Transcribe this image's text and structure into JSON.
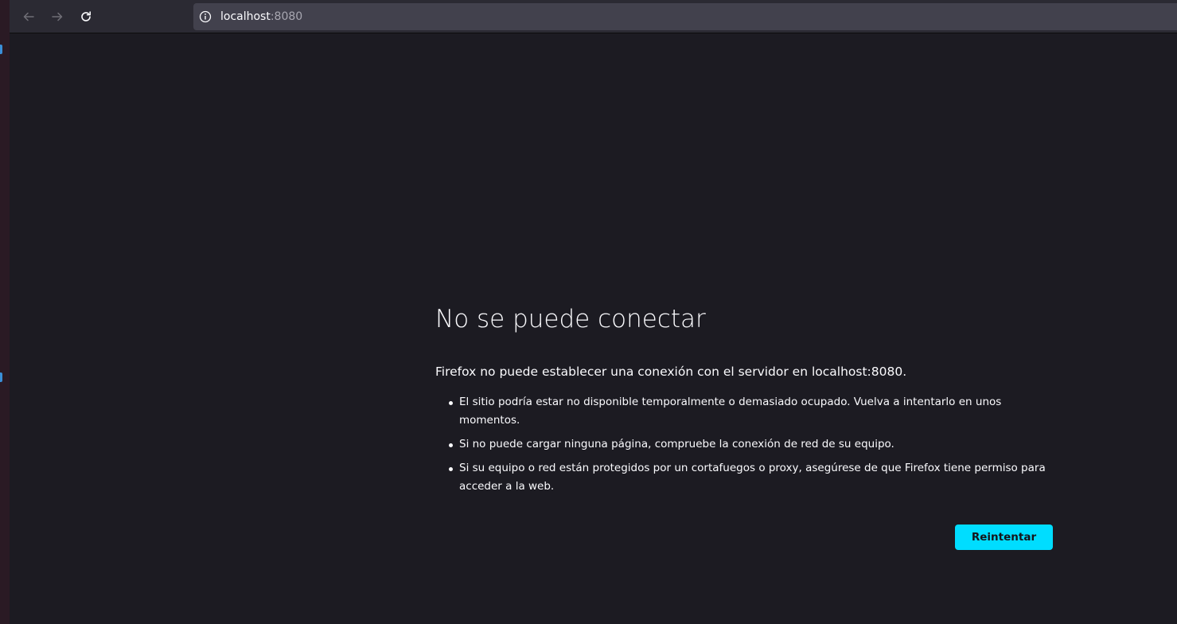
{
  "browser": {
    "url_host": "localhost",
    "url_port": ":8080",
    "icons": {
      "back": "arrow-left-icon",
      "forward": "arrow-right-icon",
      "reload": "reload-icon",
      "site_info": "info-icon"
    }
  },
  "error": {
    "title": "No se puede conectar",
    "intro": "Firefox no puede establecer una conexión con el servidor en localhost:8080.",
    "items": [
      "El sitio podría estar no disponible temporalmente o demasiado ocupado. Vuelva a intentarlo en unos momentos.",
      "Si no puede cargar ninguna página, compruebe la conexión de red de su equipo.",
      "Si su equipo o red están protegidos por un cortafuegos o proxy, asegúrese de que Firefox tiene permiso para acceder a la web."
    ],
    "retry_label": "Reintentar"
  },
  "colors": {
    "page_background": "#1c1b22",
    "toolbar_background": "#2b2a33",
    "urlbar_background": "#42414d",
    "button_accent": "#00ddff",
    "text": "#fbfbfe"
  }
}
